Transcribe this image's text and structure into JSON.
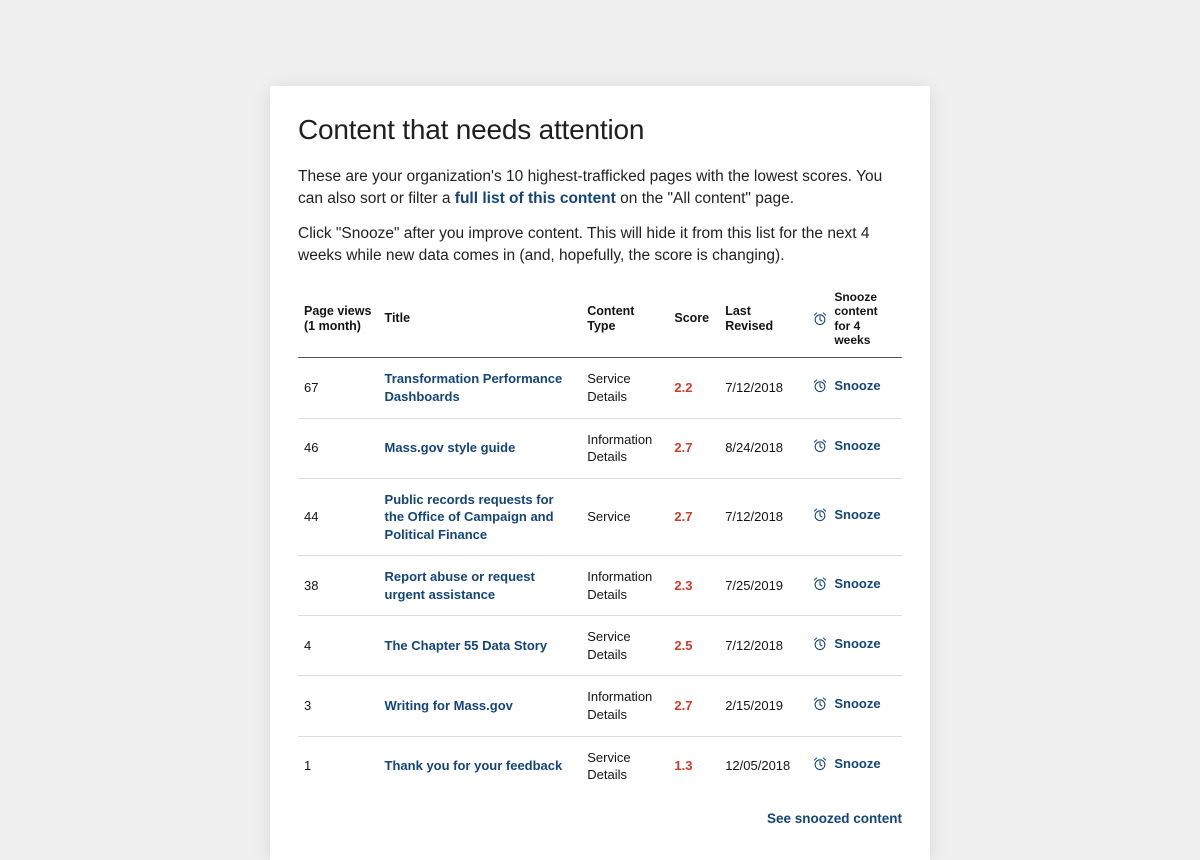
{
  "heading": "Content that needs attention",
  "intro1_prefix": "These are your organization's 10 highest-trafficked pages with the lowest scores. You can also sort or filter a ",
  "intro1_link": "full list of this content",
  "intro1_suffix": " on the \"All content\" page.",
  "intro2": "Click \"Snooze\" after you improve content. This will hide it from this list for the next 4 weeks while new data comes in (and, hopefully, the score is changing).",
  "columns": {
    "views": "Page views\n(1 month)",
    "title": "Title",
    "type": "Content Type",
    "score": "Score",
    "date": "Last Revised",
    "snooze": "Snooze content for 4 weeks"
  },
  "snooze_label": "Snooze",
  "footer_link": "See snoozed content",
  "rows": [
    {
      "views": "67",
      "title": "Transformation Performance Dashboards",
      "type": "Service Details",
      "score": "2.2",
      "date": "7/12/2018"
    },
    {
      "views": "46",
      "title": "Mass.gov style guide",
      "type": "Information Details",
      "score": "2.7",
      "date": "8/24/2018"
    },
    {
      "views": "44",
      "title": "Public records requests for the Office of Campaign and Political Finance",
      "type": "Service",
      "score": "2.7",
      "date": "7/12/2018"
    },
    {
      "views": "38",
      "title": "Report abuse or request urgent assistance",
      "type": "Information Details",
      "score": "2.3",
      "date": "7/25/2019"
    },
    {
      "views": "4",
      "title": "The Chapter 55 Data Story",
      "type": "Service Details",
      "score": "2.5",
      "date": "7/12/2018"
    },
    {
      "views": "3",
      "title": "Writing for Mass.gov",
      "type": "Information Details",
      "score": "2.7",
      "date": "2/15/2019"
    },
    {
      "views": "1",
      "title": "Thank you for your feedback",
      "type": "Service Details",
      "score": "1.3",
      "date": "12/05/2018"
    }
  ]
}
